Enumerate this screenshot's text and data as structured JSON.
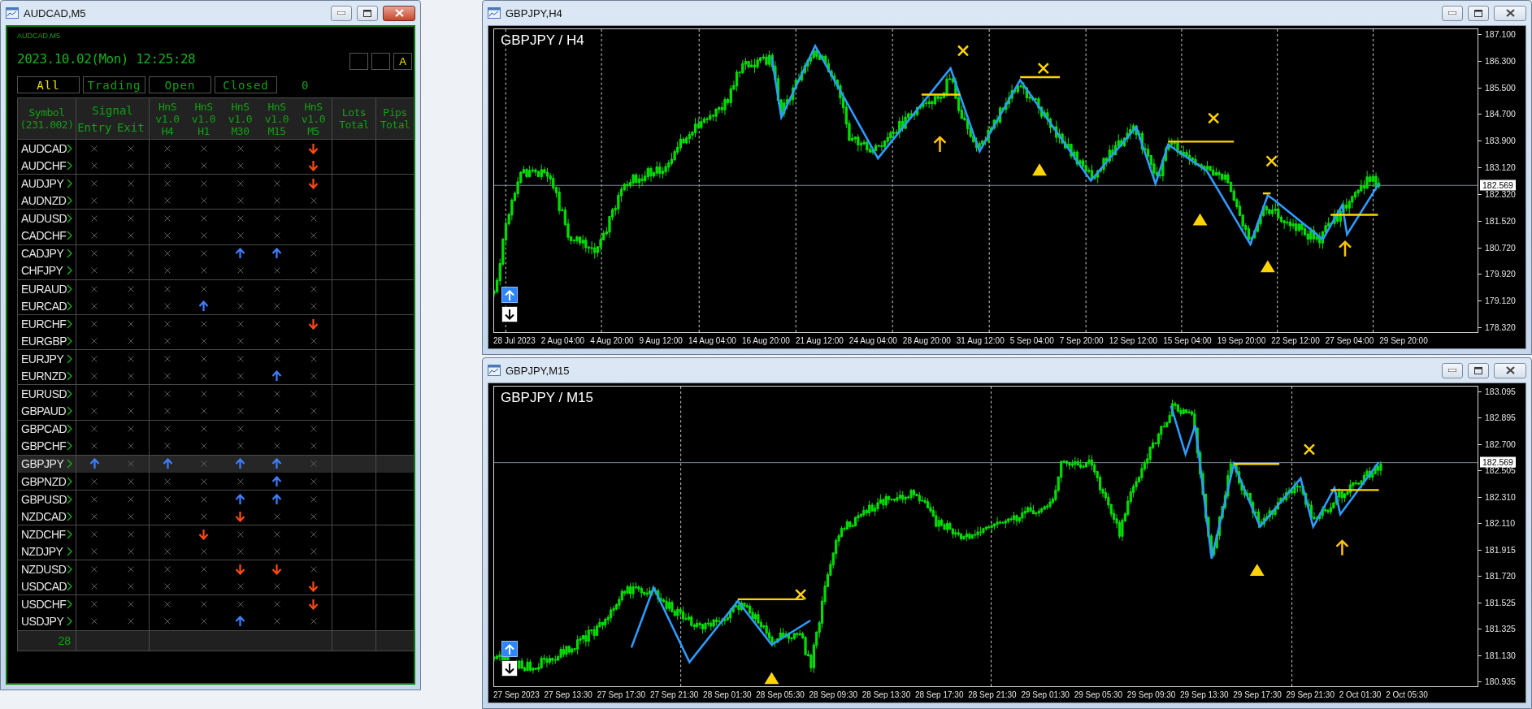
{
  "panel_window": {
    "title": "AUDCAD,M5",
    "active": true
  },
  "panel": {
    "chart_label": "AUDCAD,M5",
    "datetime": "2023.10.02(Mon) 12:25:28",
    "mode_label": "A",
    "filters": [
      {
        "label": "All",
        "selected": true
      },
      {
        "label": "Trading",
        "selected": false
      },
      {
        "label": "Open",
        "selected": false
      },
      {
        "label": "Closed",
        "selected": false
      }
    ],
    "count": "0",
    "header": {
      "symbol": "Symbol\n(231.002)",
      "signal": "Signal",
      "signal_columns": [
        "Entry",
        "Exit"
      ],
      "indicator_columns": [
        "HnS\nv1.0\nH4",
        "HnS\nv1.0\nH1",
        "HnS\nv1.0\nM30",
        "HnS\nv1.0\nM15",
        "HnS\nv1.0\nM5"
      ],
      "lots": "Lots\nTotal",
      "pips": "Pips\nTotal"
    },
    "rows": [
      {
        "symbol": "AUDCAD",
        "selected": false,
        "signals": [
          {
            "kind": "none"
          },
          {
            "kind": "none"
          },
          {
            "kind": "none"
          },
          {
            "kind": "none"
          },
          {
            "kind": "none"
          },
          {
            "kind": "none"
          },
          {
            "kind": "down"
          }
        ]
      },
      {
        "symbol": "AUDCHF",
        "selected": false,
        "signals": [
          {
            "kind": "none"
          },
          {
            "kind": "none"
          },
          {
            "kind": "none"
          },
          {
            "kind": "none"
          },
          {
            "kind": "none"
          },
          {
            "kind": "none"
          },
          {
            "kind": "down"
          }
        ]
      },
      {
        "symbol": "AUDJPY",
        "selected": false,
        "signals": [
          {
            "kind": "none"
          },
          {
            "kind": "none"
          },
          {
            "kind": "none"
          },
          {
            "kind": "none"
          },
          {
            "kind": "none"
          },
          {
            "kind": "none"
          },
          {
            "kind": "down"
          }
        ]
      },
      {
        "symbol": "AUDNZD",
        "selected": false,
        "signals": [
          {
            "kind": "none"
          },
          {
            "kind": "none"
          },
          {
            "kind": "none"
          },
          {
            "kind": "none"
          },
          {
            "kind": "none"
          },
          {
            "kind": "none"
          },
          {
            "kind": "none"
          }
        ]
      },
      {
        "symbol": "AUDUSD",
        "selected": false,
        "signals": [
          {
            "kind": "none"
          },
          {
            "kind": "none"
          },
          {
            "kind": "none"
          },
          {
            "kind": "none"
          },
          {
            "kind": "none"
          },
          {
            "kind": "none"
          },
          {
            "kind": "none"
          }
        ]
      },
      {
        "symbol": "CADCHF",
        "selected": false,
        "signals": [
          {
            "kind": "none"
          },
          {
            "kind": "none"
          },
          {
            "kind": "none"
          },
          {
            "kind": "none"
          },
          {
            "kind": "none"
          },
          {
            "kind": "none"
          },
          {
            "kind": "none"
          }
        ]
      },
      {
        "symbol": "CADJPY",
        "selected": false,
        "signals": [
          {
            "kind": "none"
          },
          {
            "kind": "none"
          },
          {
            "kind": "none"
          },
          {
            "kind": "none"
          },
          {
            "kind": "up"
          },
          {
            "kind": "up"
          },
          {
            "kind": "none"
          }
        ]
      },
      {
        "symbol": "CHFJPY",
        "selected": false,
        "signals": [
          {
            "kind": "none"
          },
          {
            "kind": "none"
          },
          {
            "kind": "none"
          },
          {
            "kind": "none"
          },
          {
            "kind": "none"
          },
          {
            "kind": "none"
          },
          {
            "kind": "none"
          }
        ]
      },
      {
        "symbol": "EURAUD",
        "selected": false,
        "signals": [
          {
            "kind": "none"
          },
          {
            "kind": "none"
          },
          {
            "kind": "none"
          },
          {
            "kind": "none"
          },
          {
            "kind": "none"
          },
          {
            "kind": "none"
          },
          {
            "kind": "none"
          }
        ]
      },
      {
        "symbol": "EURCAD",
        "selected": false,
        "signals": [
          {
            "kind": "none"
          },
          {
            "kind": "none"
          },
          {
            "kind": "none"
          },
          {
            "kind": "up"
          },
          {
            "kind": "none"
          },
          {
            "kind": "none"
          },
          {
            "kind": "none"
          }
        ]
      },
      {
        "symbol": "EURCHF",
        "selected": false,
        "signals": [
          {
            "kind": "none"
          },
          {
            "kind": "none"
          },
          {
            "kind": "none"
          },
          {
            "kind": "none"
          },
          {
            "kind": "none"
          },
          {
            "kind": "none"
          },
          {
            "kind": "down"
          }
        ]
      },
      {
        "symbol": "EURGBP",
        "selected": false,
        "signals": [
          {
            "kind": "none"
          },
          {
            "kind": "none"
          },
          {
            "kind": "none"
          },
          {
            "kind": "none"
          },
          {
            "kind": "none"
          },
          {
            "kind": "none"
          },
          {
            "kind": "none"
          }
        ]
      },
      {
        "symbol": "EURJPY",
        "selected": false,
        "signals": [
          {
            "kind": "none"
          },
          {
            "kind": "none"
          },
          {
            "kind": "none"
          },
          {
            "kind": "none"
          },
          {
            "kind": "none"
          },
          {
            "kind": "none"
          },
          {
            "kind": "none"
          }
        ]
      },
      {
        "symbol": "EURNZD",
        "selected": false,
        "signals": [
          {
            "kind": "none"
          },
          {
            "kind": "none"
          },
          {
            "kind": "none"
          },
          {
            "kind": "none"
          },
          {
            "kind": "none"
          },
          {
            "kind": "up"
          },
          {
            "kind": "none"
          }
        ]
      },
      {
        "symbol": "EURUSD",
        "selected": false,
        "signals": [
          {
            "kind": "none"
          },
          {
            "kind": "none"
          },
          {
            "kind": "none"
          },
          {
            "kind": "none"
          },
          {
            "kind": "none"
          },
          {
            "kind": "none"
          },
          {
            "kind": "none"
          }
        ]
      },
      {
        "symbol": "GBPAUD",
        "selected": false,
        "signals": [
          {
            "kind": "none"
          },
          {
            "kind": "none"
          },
          {
            "kind": "none"
          },
          {
            "kind": "none"
          },
          {
            "kind": "none"
          },
          {
            "kind": "none"
          },
          {
            "kind": "none"
          }
        ]
      },
      {
        "symbol": "GBPCAD",
        "selected": false,
        "signals": [
          {
            "kind": "none"
          },
          {
            "kind": "none"
          },
          {
            "kind": "none"
          },
          {
            "kind": "none"
          },
          {
            "kind": "none"
          },
          {
            "kind": "none"
          },
          {
            "kind": "none"
          }
        ]
      },
      {
        "symbol": "GBPCHF",
        "selected": false,
        "signals": [
          {
            "kind": "none"
          },
          {
            "kind": "none"
          },
          {
            "kind": "none"
          },
          {
            "kind": "none"
          },
          {
            "kind": "none"
          },
          {
            "kind": "none"
          },
          {
            "kind": "none"
          }
        ]
      },
      {
        "symbol": "GBPJPY",
        "selected": true,
        "signals": [
          {
            "kind": "up"
          },
          {
            "kind": "none"
          },
          {
            "kind": "up"
          },
          {
            "kind": "none"
          },
          {
            "kind": "up"
          },
          {
            "kind": "up"
          },
          {
            "kind": "none"
          }
        ]
      },
      {
        "symbol": "GBPNZD",
        "selected": false,
        "signals": [
          {
            "kind": "none"
          },
          {
            "kind": "none"
          },
          {
            "kind": "none"
          },
          {
            "kind": "none"
          },
          {
            "kind": "none"
          },
          {
            "kind": "up"
          },
          {
            "kind": "none"
          }
        ]
      },
      {
        "symbol": "GBPUSD",
        "selected": false,
        "signals": [
          {
            "kind": "none"
          },
          {
            "kind": "none"
          },
          {
            "kind": "none"
          },
          {
            "kind": "none"
          },
          {
            "kind": "up"
          },
          {
            "kind": "up"
          },
          {
            "kind": "none"
          }
        ]
      },
      {
        "symbol": "NZDCAD",
        "selected": false,
        "signals": [
          {
            "kind": "none"
          },
          {
            "kind": "none"
          },
          {
            "kind": "none"
          },
          {
            "kind": "none"
          },
          {
            "kind": "down"
          },
          {
            "kind": "none"
          },
          {
            "kind": "none"
          }
        ]
      },
      {
        "symbol": "NZDCHF",
        "selected": false,
        "signals": [
          {
            "kind": "none"
          },
          {
            "kind": "none"
          },
          {
            "kind": "none"
          },
          {
            "kind": "down"
          },
          {
            "kind": "none"
          },
          {
            "kind": "none"
          },
          {
            "kind": "none"
          }
        ]
      },
      {
        "symbol": "NZDJPY",
        "selected": false,
        "signals": [
          {
            "kind": "none"
          },
          {
            "kind": "none"
          },
          {
            "kind": "none"
          },
          {
            "kind": "none"
          },
          {
            "kind": "none"
          },
          {
            "kind": "none"
          },
          {
            "kind": "none"
          }
        ]
      },
      {
        "symbol": "NZDUSD",
        "selected": false,
        "signals": [
          {
            "kind": "none"
          },
          {
            "kind": "none"
          },
          {
            "kind": "none"
          },
          {
            "kind": "none"
          },
          {
            "kind": "down"
          },
          {
            "kind": "down"
          },
          {
            "kind": "none"
          }
        ]
      },
      {
        "symbol": "USDCAD",
        "selected": false,
        "signals": [
          {
            "kind": "none"
          },
          {
            "kind": "none"
          },
          {
            "kind": "none"
          },
          {
            "kind": "none"
          },
          {
            "kind": "none"
          },
          {
            "kind": "none"
          },
          {
            "kind": "down"
          }
        ]
      },
      {
        "symbol": "USDCHF",
        "selected": false,
        "signals": [
          {
            "kind": "none"
          },
          {
            "kind": "none"
          },
          {
            "kind": "none"
          },
          {
            "kind": "none"
          },
          {
            "kind": "none"
          },
          {
            "kind": "none"
          },
          {
            "kind": "down"
          }
        ]
      },
      {
        "symbol": "USDJPY",
        "selected": false,
        "signals": [
          {
            "kind": "none"
          },
          {
            "kind": "none"
          },
          {
            "kind": "none"
          },
          {
            "kind": "none"
          },
          {
            "kind": "up"
          },
          {
            "kind": "none"
          },
          {
            "kind": "none"
          }
        ]
      }
    ],
    "footer_count": "28"
  },
  "charts": [
    {
      "window_title": "GBPJPY,H4",
      "active": false,
      "label": "GBPJPY / H4",
      "current_price": "182.569",
      "price_ticks": [
        "187.100",
        "186.300",
        "185.500",
        "184.700",
        "183.900",
        "183.120",
        "182.320",
        "181.520",
        "180.720",
        "179.920",
        "179.120",
        "178.320"
      ],
      "time_labels": [
        "28 Jul 2023",
        "2 Aug 04:00",
        "4 Aug 20:00",
        "9 Aug 12:00",
        "14 Aug 04:00",
        "16 Aug 20:00",
        "21 Aug 12:00",
        "24 Aug 04:00",
        "28 Aug 20:00",
        "31 Aug 12:00",
        "5 Sep 04:00",
        "7 Sep 20:00",
        "12 Sep 12:00",
        "15 Sep 04:00",
        "19 Sep 20:00",
        "22 Sep 12:00",
        "27 Sep 04:00",
        "29 Sep 20:00"
      ]
    },
    {
      "window_title": "GBPJPY,M15",
      "active": false,
      "label": "GBPJPY / M15",
      "current_price": "182.569",
      "price_ticks": [
        "183.095",
        "182.895",
        "182.700",
        "182.505",
        "182.310",
        "182.110",
        "181.915",
        "181.720",
        "181.525",
        "181.325",
        "181.130",
        "180.935"
      ],
      "time_labels": [
        "27 Sep 2023",
        "27 Sep 13:30",
        "27 Sep 17:30",
        "27 Sep 21:30",
        "28 Sep 01:30",
        "28 Sep 05:30",
        "28 Sep 09:30",
        "28 Sep 13:30",
        "28 Sep 17:30",
        "28 Sep 21:30",
        "29 Sep 01:30",
        "29 Sep 05:30",
        "29 Sep 09:30",
        "29 Sep 13:30",
        "29 Sep 17:30",
        "29 Sep 21:30",
        "2 Oct 01:30",
        "2 Oct 05:30"
      ]
    }
  ]
}
